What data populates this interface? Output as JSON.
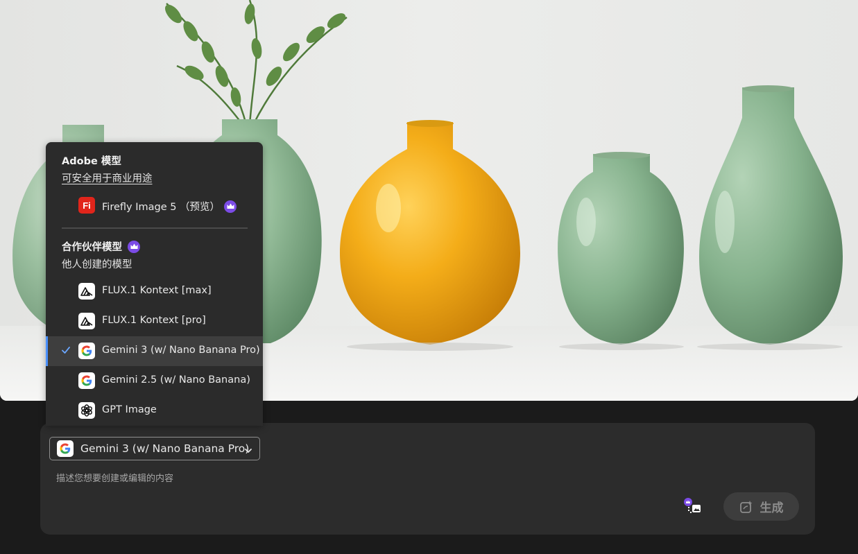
{
  "hero": {
    "description_icon": "vases-photo"
  },
  "dropdown": {
    "adobe_section": {
      "title": "Adobe 模型",
      "subtitle": "可安全用于商业用途",
      "items": [
        {
          "label": "Firefly Image 5 （预览）",
          "icon": "firefly-icon",
          "icon_text": "Fi",
          "premium": true
        }
      ]
    },
    "partner_section": {
      "title": "合作伙伴模型",
      "subtitle": "他人创建的模型",
      "items": [
        {
          "label": "FLUX.1 Kontext [max]",
          "icon": "flux-icon",
          "selected": false
        },
        {
          "label": "FLUX.1 Kontext [pro]",
          "icon": "flux-icon",
          "selected": false
        },
        {
          "label": "Gemini 3 (w/ Nano Banana Pro)",
          "icon": "google-icon",
          "selected": true
        },
        {
          "label": "Gemini 2.5 (w/ Nano Banana)",
          "icon": "google-icon",
          "selected": false
        },
        {
          "label": "GPT Image",
          "icon": "openai-icon",
          "selected": false
        }
      ]
    }
  },
  "prompt": {
    "model_selector_label": "Gemini 3 (w/ Nano Banana Pro)",
    "placeholder": "描述您想要创建或编辑的内容",
    "generate_label": "生成"
  },
  "colors": {
    "accent": "#4a90ff",
    "premium": "#7b4be6",
    "firefly_red": "#e1251b"
  }
}
